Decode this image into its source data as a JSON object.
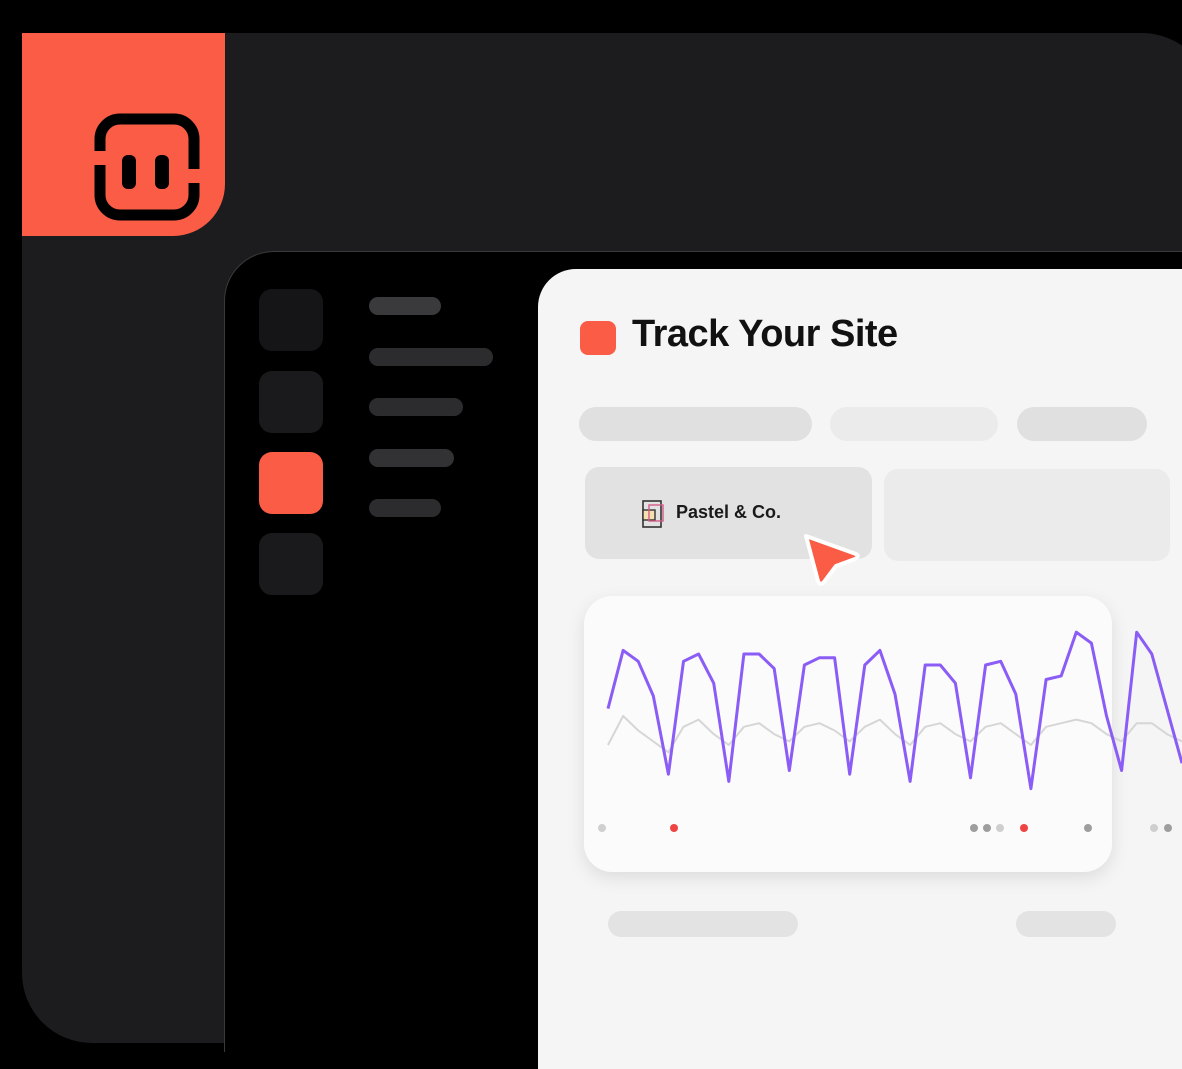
{
  "app": {
    "accent": "#fa5c45",
    "logo_icon": "app-logo-icon"
  },
  "sidebar": {
    "items": [
      {
        "icon": "nav-square-icon",
        "active": false
      },
      {
        "icon": "nav-square-icon",
        "active": false
      },
      {
        "icon": "nav-square-icon",
        "active": true
      },
      {
        "icon": "nav-square-icon",
        "active": false
      }
    ]
  },
  "main": {
    "title": "Track Your Site",
    "site_tile": {
      "label": "Pastel & Co.",
      "icon": "pastel-logo-icon"
    },
    "cursor_icon": "pointer-cursor-icon"
  },
  "chart_data": {
    "type": "line",
    "series": [
      {
        "color": "#8b5cf6",
        "values": [
          48,
          80,
          74,
          55,
          12,
          74,
          78,
          62,
          8,
          78,
          78,
          70,
          14,
          72,
          76,
          76,
          12,
          72,
          80,
          56,
          8,
          72,
          72,
          62,
          10,
          72,
          74,
          56,
          4,
          64,
          66,
          90,
          84,
          44,
          14,
          90,
          78,
          48,
          18
        ]
      },
      {
        "color": "#d6d6d6",
        "values": [
          28,
          44,
          36,
          30,
          24,
          38,
          42,
          34,
          28,
          38,
          40,
          34,
          30,
          38,
          40,
          36,
          30,
          38,
          42,
          34,
          28,
          38,
          40,
          34,
          30,
          38,
          40,
          34,
          28,
          38,
          40,
          42,
          40,
          34,
          30,
          40,
          40,
          34,
          30
        ]
      }
    ],
    "ylim": [
      0,
      100
    ],
    "markers": {
      "colors": [
        "#cfcfcf",
        "#ef4444",
        "#9e9e9e",
        "#9e9e9e",
        "#cfcfcf",
        "#ef4444",
        "#9e9e9e",
        "#cfcfcf",
        "#9e9e9e"
      ]
    }
  }
}
